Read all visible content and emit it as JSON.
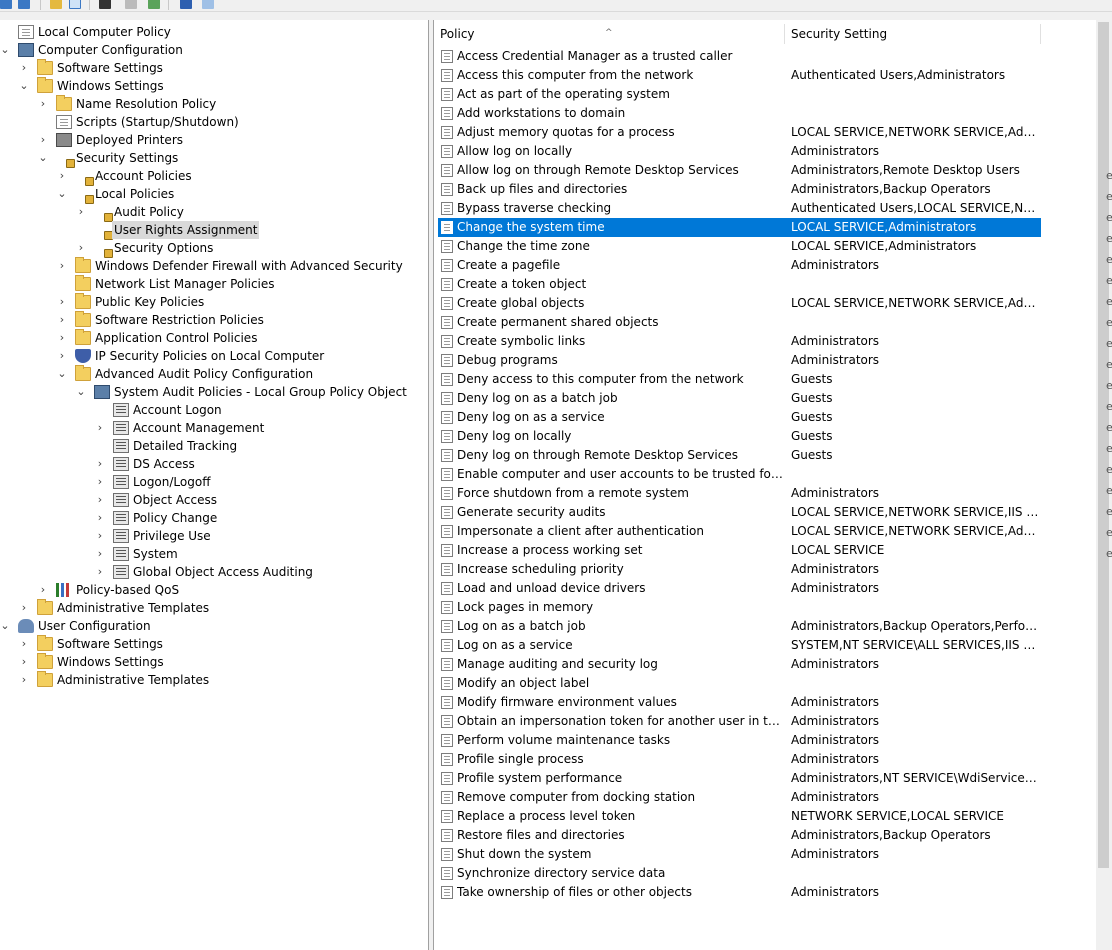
{
  "tree": [
    {
      "label": "Local Computer Policy",
      "depth": 0,
      "expander": "",
      "icon": "doc",
      "selected": false
    },
    {
      "label": "Computer Configuration",
      "depth": 0,
      "expander": "v",
      "icon": "computer",
      "selected": false
    },
    {
      "label": "Software Settings",
      "depth": 1,
      "expander": ">",
      "icon": "folder",
      "selected": false
    },
    {
      "label": "Windows Settings",
      "depth": 1,
      "expander": "v",
      "icon": "folder",
      "selected": false
    },
    {
      "label": "Name Resolution Policy",
      "depth": 2,
      "expander": ">",
      "icon": "folder",
      "selected": false
    },
    {
      "label": "Scripts (Startup/Shutdown)",
      "depth": 2,
      "expander": "",
      "icon": "doc",
      "selected": false
    },
    {
      "label": "Deployed Printers",
      "depth": 2,
      "expander": ">",
      "icon": "printer",
      "selected": false
    },
    {
      "label": "Security Settings",
      "depth": 2,
      "expander": "v",
      "icon": "folder-lock",
      "selected": false
    },
    {
      "label": "Account Policies",
      "depth": 3,
      "expander": ">",
      "icon": "folder-lock",
      "selected": false
    },
    {
      "label": "Local Policies",
      "depth": 3,
      "expander": "v",
      "icon": "folder-lock",
      "selected": false
    },
    {
      "label": "Audit Policy",
      "depth": 4,
      "expander": ">",
      "icon": "folder-lock",
      "selected": false
    },
    {
      "label": "User Rights Assignment",
      "depth": 4,
      "expander": "",
      "icon": "folder-lock",
      "selected": true
    },
    {
      "label": "Security Options",
      "depth": 4,
      "expander": ">",
      "icon": "folder-lock",
      "selected": false
    },
    {
      "label": "Windows Defender Firewall with Advanced Security",
      "depth": 3,
      "expander": ">",
      "icon": "folder",
      "selected": false
    },
    {
      "label": "Network List Manager Policies",
      "depth": 3,
      "expander": "",
      "icon": "folder",
      "selected": false
    },
    {
      "label": "Public Key Policies",
      "depth": 3,
      "expander": ">",
      "icon": "folder",
      "selected": false
    },
    {
      "label": "Software Restriction Policies",
      "depth": 3,
      "expander": ">",
      "icon": "folder",
      "selected": false
    },
    {
      "label": "Application Control Policies",
      "depth": 3,
      "expander": ">",
      "icon": "folder",
      "selected": false
    },
    {
      "label": "IP Security Policies on Local Computer",
      "depth": 3,
      "expander": ">",
      "icon": "shield",
      "selected": false
    },
    {
      "label": "Advanced Audit Policy Configuration",
      "depth": 3,
      "expander": "v",
      "icon": "folder",
      "selected": false
    },
    {
      "label": "System Audit Policies - Local Group Policy Object",
      "depth": 4,
      "expander": "v",
      "icon": "computer",
      "selected": false
    },
    {
      "label": "Account Logon",
      "depth": 5,
      "expander": "",
      "icon": "audit",
      "selected": false
    },
    {
      "label": "Account Management",
      "depth": 5,
      "expander": ">",
      "icon": "audit",
      "selected": false
    },
    {
      "label": "Detailed Tracking",
      "depth": 5,
      "expander": "",
      "icon": "audit",
      "selected": false
    },
    {
      "label": "DS Access",
      "depth": 5,
      "expander": ">",
      "icon": "audit",
      "selected": false
    },
    {
      "label": "Logon/Logoff",
      "depth": 5,
      "expander": ">",
      "icon": "audit",
      "selected": false
    },
    {
      "label": "Object Access",
      "depth": 5,
      "expander": ">",
      "icon": "audit",
      "selected": false
    },
    {
      "label": "Policy Change",
      "depth": 5,
      "expander": ">",
      "icon": "audit",
      "selected": false
    },
    {
      "label": "Privilege Use",
      "depth": 5,
      "expander": ">",
      "icon": "audit",
      "selected": false
    },
    {
      "label": "System",
      "depth": 5,
      "expander": ">",
      "icon": "audit",
      "selected": false
    },
    {
      "label": "Global Object Access Auditing",
      "depth": 5,
      "expander": ">",
      "icon": "audit",
      "selected": false
    },
    {
      "label": "Policy-based QoS",
      "depth": 2,
      "expander": ">",
      "icon": "barchart",
      "selected": false
    },
    {
      "label": "Administrative Templates",
      "depth": 1,
      "expander": ">",
      "icon": "folder",
      "selected": false
    },
    {
      "label": "User Configuration",
      "depth": 0,
      "expander": "v",
      "icon": "user",
      "selected": false
    },
    {
      "label": "Software Settings",
      "depth": 1,
      "expander": ">",
      "icon": "folder",
      "selected": false
    },
    {
      "label": "Windows Settings",
      "depth": 1,
      "expander": ">",
      "icon": "folder",
      "selected": false
    },
    {
      "label": "Administrative Templates",
      "depth": 1,
      "expander": ">",
      "icon": "folder",
      "selected": false
    }
  ],
  "columns": {
    "policy": "Policy",
    "setting": "Security Setting"
  },
  "policies": [
    {
      "name": "Access Credential Manager as a trusted caller",
      "setting": "",
      "selected": false
    },
    {
      "name": "Access this computer from the network",
      "setting": "Authenticated Users,Administrators",
      "selected": false
    },
    {
      "name": "Act as part of the operating system",
      "setting": "",
      "selected": false
    },
    {
      "name": "Add workstations to domain",
      "setting": "",
      "selected": false
    },
    {
      "name": "Adjust memory quotas for a process",
      "setting": "LOCAL SERVICE,NETWORK SERVICE,Adminis...",
      "selected": false
    },
    {
      "name": "Allow log on locally",
      "setting": "Administrators",
      "selected": false
    },
    {
      "name": "Allow log on through Remote Desktop Services",
      "setting": "Administrators,Remote Desktop Users",
      "selected": false
    },
    {
      "name": "Back up files and directories",
      "setting": "Administrators,Backup Operators",
      "selected": false
    },
    {
      "name": "Bypass traverse checking",
      "setting": "Authenticated Users,LOCAL SERVICE,NETW...",
      "selected": false
    },
    {
      "name": "Change the system time",
      "setting": "LOCAL SERVICE,Administrators",
      "selected": true
    },
    {
      "name": "Change the time zone",
      "setting": "LOCAL SERVICE,Administrators",
      "selected": false
    },
    {
      "name": "Create a pagefile",
      "setting": "Administrators",
      "selected": false
    },
    {
      "name": "Create a token object",
      "setting": "",
      "selected": false
    },
    {
      "name": "Create global objects",
      "setting": "LOCAL SERVICE,NETWORK SERVICE,Adminis...",
      "selected": false
    },
    {
      "name": "Create permanent shared objects",
      "setting": "",
      "selected": false
    },
    {
      "name": "Create symbolic links",
      "setting": "Administrators",
      "selected": false
    },
    {
      "name": "Debug programs",
      "setting": "Administrators",
      "selected": false
    },
    {
      "name": "Deny access to this computer from the network",
      "setting": "Guests",
      "selected": false
    },
    {
      "name": "Deny log on as a batch job",
      "setting": "Guests",
      "selected": false
    },
    {
      "name": "Deny log on as a service",
      "setting": "Guests",
      "selected": false
    },
    {
      "name": "Deny log on locally",
      "setting": "Guests",
      "selected": false
    },
    {
      "name": "Deny log on through Remote Desktop Services",
      "setting": "Guests",
      "selected": false
    },
    {
      "name": "Enable computer and user accounts to be trusted for delega...",
      "setting": "",
      "selected": false
    },
    {
      "name": "Force shutdown from a remote system",
      "setting": "Administrators",
      "selected": false
    },
    {
      "name": "Generate security audits",
      "setting": "LOCAL SERVICE,NETWORK SERVICE,IIS APPP...",
      "selected": false
    },
    {
      "name": "Impersonate a client after authentication",
      "setting": "LOCAL SERVICE,NETWORK SERVICE,Adminis...",
      "selected": false
    },
    {
      "name": "Increase a process working set",
      "setting": "LOCAL SERVICE",
      "selected": false
    },
    {
      "name": "Increase scheduling priority",
      "setting": "Administrators",
      "selected": false
    },
    {
      "name": "Load and unload device drivers",
      "setting": "Administrators",
      "selected": false
    },
    {
      "name": "Lock pages in memory",
      "setting": "",
      "selected": false
    },
    {
      "name": "Log on as a batch job",
      "setting": "Administrators,Backup Operators,Performan...",
      "selected": false
    },
    {
      "name": "Log on as a service",
      "setting": "SYSTEM,NT SERVICE\\ALL SERVICES,IIS APPP...",
      "selected": false
    },
    {
      "name": "Manage auditing and security log",
      "setting": "Administrators",
      "selected": false
    },
    {
      "name": "Modify an object label",
      "setting": "",
      "selected": false
    },
    {
      "name": "Modify firmware environment values",
      "setting": "Administrators",
      "selected": false
    },
    {
      "name": "Obtain an impersonation token for another user in the same...",
      "setting": "Administrators",
      "selected": false
    },
    {
      "name": "Perform volume maintenance tasks",
      "setting": "Administrators",
      "selected": false
    },
    {
      "name": "Profile single process",
      "setting": "Administrators",
      "selected": false
    },
    {
      "name": "Profile system performance",
      "setting": "Administrators,NT SERVICE\\WdiServiceHost",
      "selected": false
    },
    {
      "name": "Remove computer from docking station",
      "setting": "Administrators",
      "selected": false
    },
    {
      "name": "Replace a process level token",
      "setting": "NETWORK SERVICE,LOCAL SERVICE",
      "selected": false
    },
    {
      "name": "Restore files and directories",
      "setting": "Administrators,Backup Operators",
      "selected": false
    },
    {
      "name": "Shut down the system",
      "setting": "Administrators",
      "selected": false
    },
    {
      "name": "Synchronize directory service data",
      "setting": "",
      "selected": false
    },
    {
      "name": "Take ownership of files or other objects",
      "setting": "Administrators",
      "selected": false
    }
  ],
  "toolbar_icons": [
    "back-icon",
    "forward-icon",
    "up-folder-icon",
    "show-hide-tree-icon",
    "delete-icon",
    "properties-icon",
    "export-list-icon",
    "help-icon",
    "action-pane-icon"
  ],
  "colors": {
    "selection": "#0078d7",
    "tree_selection": "#d9d9d9",
    "folder": "#f3cf5f"
  }
}
